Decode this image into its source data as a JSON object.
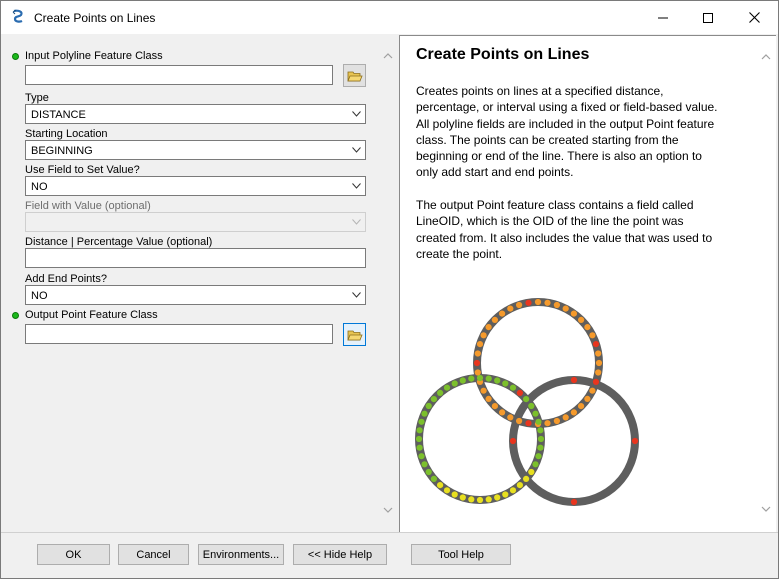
{
  "window": {
    "title": "Create Points on Lines",
    "controls": {
      "minimize_icon": "minimize-icon",
      "maximize_icon": "maximize-icon",
      "close_icon": "close-icon"
    }
  },
  "form": {
    "input_features": {
      "label": "Input Polyline Feature Class",
      "value": "",
      "required": true
    },
    "type": {
      "label": "Type",
      "value": "DISTANCE"
    },
    "starting_location": {
      "label": "Starting Location",
      "value": "BEGINNING"
    },
    "use_field": {
      "label": "Use Field to Set Value?",
      "value": "NO"
    },
    "field_with_value": {
      "label": "Field with Value (optional)",
      "value": "",
      "disabled": true
    },
    "distance_value": {
      "label": "Distance | Percentage Value (optional)",
      "value": ""
    },
    "add_end_points": {
      "label": "Add End Points?",
      "value": "NO"
    },
    "output_features": {
      "label": "Output Point Feature Class",
      "value": "",
      "required": true
    }
  },
  "help": {
    "title": "Create Points on Lines",
    "paragraph1_lines": [
      "Creates points on lines at a specified distance,",
      "percentage, or interval using a fixed or field-based value.",
      "All polyline fields are included in the output Point feature",
      "class. The points can be created starting from the",
      "beginning or end of the line. There is also an option to",
      "only add start and end points."
    ],
    "paragraph2_lines": [
      "The output Point feature class contains a field called",
      "LineOID, which is the OID of the line the point was",
      "created from. It also includes the value that was used to",
      "create the point."
    ],
    "colors": {
      "ring": "#5e5e5e",
      "orange": "#f59a2c",
      "red": "#e8351e",
      "green": "#7cc02c",
      "yellow": "#e8e020"
    }
  },
  "buttons": {
    "ok": "OK",
    "cancel": "Cancel",
    "environments": "Environments...",
    "hide_help": "<< Hide Help",
    "tool_help": "Tool Help"
  }
}
